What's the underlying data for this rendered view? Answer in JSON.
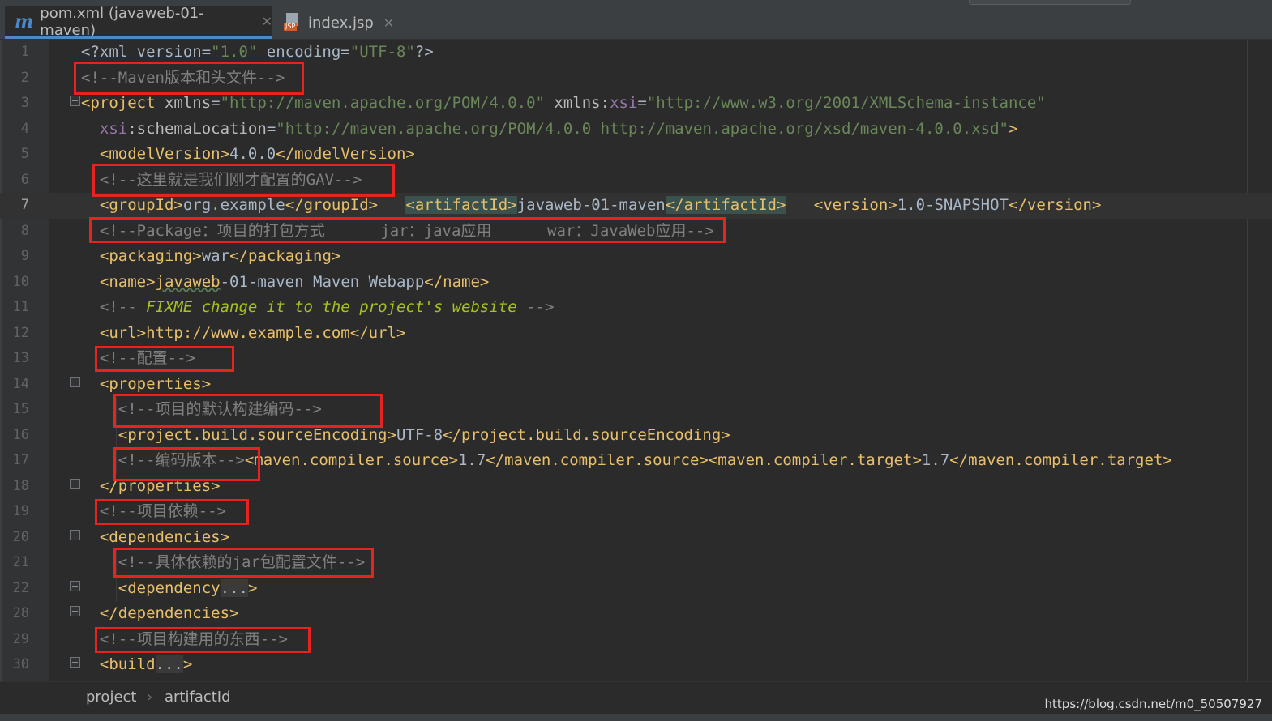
{
  "tabs": [
    {
      "label": "pom.xml (javaweb-01-maven)",
      "icon": "maven-m-icon",
      "active": true
    },
    {
      "label": "index.jsp",
      "icon": "jsp-file-icon",
      "icon_text": "JSP",
      "active": false
    }
  ],
  "colors": {
    "background": "#2b2b2b",
    "tag": "#e8bf6a",
    "attribute_value": "#6a8759",
    "comment": "#808080",
    "annotation_box": "#e8231f",
    "active_tab_underline": "#4a88c7"
  },
  "code": {
    "lines": [
      {
        "n": "1",
        "s": [
          [
            "x",
            "<?xml version="
          ],
          [
            "v",
            "\"1.0\""
          ],
          [
            "x",
            " encoding="
          ],
          [
            "v",
            "\"UTF-8\""
          ],
          [
            "x",
            "?>"
          ]
        ]
      },
      {
        "n": "2",
        "s": [
          [
            "c",
            "<!--Maven版本和头文件-->"
          ]
        ]
      },
      {
        "n": "3",
        "s": [
          [
            "t",
            "<project "
          ],
          [
            "a",
            "xmlns"
          ],
          [
            "x",
            "="
          ],
          [
            "v",
            "\"http://maven.apache.org/POM/4.0.0\""
          ],
          [
            "a",
            " xmlns:"
          ],
          [
            "ns",
            "xsi"
          ],
          [
            "x",
            "="
          ],
          [
            "v",
            "\"http://www.w3.org/2001/XMLSchema-instance\""
          ]
        ]
      },
      {
        "n": "4",
        "s": [
          [
            "x",
            "  "
          ],
          [
            "ns",
            "xsi"
          ],
          [
            "a",
            ":schemaLocation"
          ],
          [
            "x",
            "="
          ],
          [
            "v",
            "\"http://maven.apache.org/POM/4.0.0 http://maven.apache.org/xsd/maven-4.0.0.xsd\""
          ],
          [
            "t",
            ">"
          ]
        ]
      },
      {
        "n": "5",
        "s": [
          [
            "x",
            "  "
          ],
          [
            "t",
            "<modelVersion>"
          ],
          [
            "x",
            "4.0.0"
          ],
          [
            "t",
            "</modelVersion>"
          ]
        ]
      },
      {
        "n": "6",
        "s": [
          [
            "x",
            "  "
          ],
          [
            "c",
            "<!--这里就是我们刚才配置的GAV-->"
          ]
        ]
      },
      {
        "n": "7",
        "s": [
          [
            "x",
            "  "
          ],
          [
            "t",
            "<groupId>"
          ],
          [
            "x",
            "org.example"
          ],
          [
            "t",
            "</groupId>"
          ],
          [
            "x",
            "   "
          ],
          [
            "hl",
            "<artifactId>"
          ],
          [
            "x",
            "javaweb-01-maven"
          ],
          [
            "hl",
            "</artifactId>"
          ],
          [
            "x",
            "   "
          ],
          [
            "t",
            "<version>"
          ],
          [
            "x",
            "1.0-SNAPSHOT"
          ],
          [
            "t",
            "</version>"
          ]
        ]
      },
      {
        "n": "8",
        "s": [
          [
            "x",
            "  "
          ],
          [
            "c",
            "<!--Package：项目的打包方式      jar：java应用      war：JavaWeb应用-->"
          ]
        ]
      },
      {
        "n": "9",
        "s": [
          [
            "x",
            "  "
          ],
          [
            "t",
            "<packaging>"
          ],
          [
            "x",
            "war"
          ],
          [
            "t",
            "</packaging>"
          ]
        ]
      },
      {
        "n": "10",
        "s": [
          [
            "x",
            "  "
          ],
          [
            "t",
            "<name>"
          ],
          [
            "wavy",
            "javaweb"
          ],
          [
            "x",
            "-01-maven Maven Webapp"
          ],
          [
            "t",
            "</name>"
          ]
        ]
      },
      {
        "n": "11",
        "s": [
          [
            "x",
            "  "
          ],
          [
            "c",
            "<!-- "
          ],
          [
            "fix",
            "FIXME change it to the project's website"
          ],
          [
            "c",
            " -->"
          ]
        ]
      },
      {
        "n": "12",
        "s": [
          [
            "x",
            "  "
          ],
          [
            "t",
            "<url>"
          ],
          [
            "ul",
            "http://www.example.com"
          ],
          [
            "t",
            "</url>"
          ]
        ]
      },
      {
        "n": "13",
        "s": [
          [
            "x",
            "  "
          ],
          [
            "c",
            "<!--配置-->"
          ]
        ]
      },
      {
        "n": "14",
        "s": [
          [
            "x",
            "  "
          ],
          [
            "t",
            "<properties>"
          ]
        ]
      },
      {
        "n": "15",
        "s": [
          [
            "x",
            "    "
          ],
          [
            "c",
            "<!--项目的默认构建编码-->"
          ]
        ]
      },
      {
        "n": "16",
        "s": [
          [
            "x",
            "    "
          ],
          [
            "t",
            "<project.build.sourceEncoding>"
          ],
          [
            "x",
            "UTF-8"
          ],
          [
            "t",
            "</project.build.sourceEncoding>"
          ]
        ]
      },
      {
        "n": "17",
        "s": [
          [
            "x",
            "    "
          ],
          [
            "c",
            "<!--编码版本-->"
          ],
          [
            "t",
            "<maven.compiler.source>"
          ],
          [
            "x",
            "1.7"
          ],
          [
            "t",
            "</maven.compiler.source><maven.compiler.target>"
          ],
          [
            "x",
            "1.7"
          ],
          [
            "t",
            "</maven.compiler.target>"
          ]
        ]
      },
      {
        "n": "18",
        "s": [
          [
            "x",
            "  "
          ],
          [
            "t",
            "</properties>"
          ]
        ]
      },
      {
        "n": "19",
        "s": [
          [
            "x",
            "  "
          ],
          [
            "c",
            "<!--项目依赖-->"
          ]
        ]
      },
      {
        "n": "20",
        "s": [
          [
            "x",
            "  "
          ],
          [
            "t",
            "<dependencies>"
          ]
        ]
      },
      {
        "n": "21",
        "s": [
          [
            "x",
            "    "
          ],
          [
            "c",
            "<!--具体依赖的jar包配置文件-->"
          ]
        ]
      },
      {
        "n": "22",
        "s": [
          [
            "x",
            "    "
          ],
          [
            "t",
            "<dependency"
          ],
          [
            "fld",
            "..."
          ],
          [
            "t",
            ">"
          ]
        ]
      },
      {
        "n": "28",
        "s": [
          [
            "x",
            "  "
          ],
          [
            "t",
            "</dependencies>"
          ]
        ]
      },
      {
        "n": "29",
        "s": [
          [
            "x",
            "  "
          ],
          [
            "c",
            "<!--项目构建用的东西-->"
          ]
        ]
      },
      {
        "n": "30",
        "s": [
          [
            "x",
            "  "
          ],
          [
            "t",
            "<build"
          ],
          [
            "fld",
            "..."
          ],
          [
            "t",
            ">"
          ]
        ]
      }
    ]
  },
  "breadcrumb": [
    "project",
    "artifactId"
  ],
  "breadcrumb_separator": "›",
  "watermark": "https://blog.csdn.net/m0_50507927"
}
